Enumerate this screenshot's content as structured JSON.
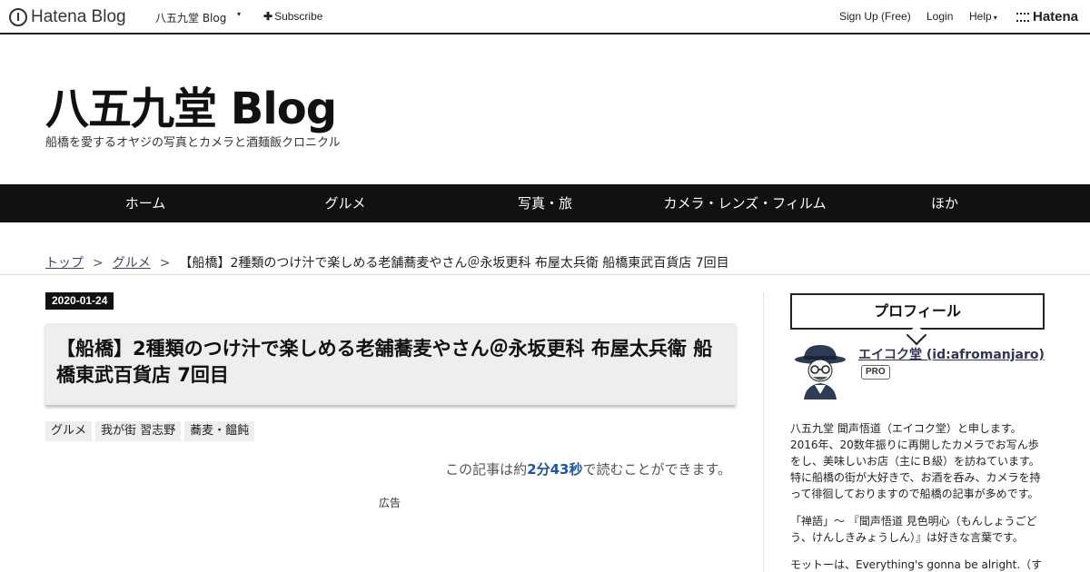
{
  "topbar": {
    "logo_text": "Hatena Blog",
    "blog_selector": "八五九堂 Blog",
    "caret": "▾",
    "subscribe": "Subscribe",
    "signup": "Sign Up (Free)",
    "login": "Login",
    "help": "Help",
    "help_caret": "▾",
    "hatena": "Hatena"
  },
  "header": {
    "title": "八五九堂 Blog",
    "description": "船橋を愛するオヤジの写真とカメラと酒麺飯クロニクル"
  },
  "nav": {
    "items": [
      "ホーム",
      "グルメ",
      "写真・旅",
      "カメラ・レンズ・フィルム",
      "ほか"
    ]
  },
  "breadcrumb": {
    "top": "トップ",
    "category": "グルメ",
    "separator": ">",
    "current": "【船橋】2種類のつけ汁で楽しめる老舗蕎麦やさん＠永坂更科 布屋太兵衛 船橋東武百貨店 7回目"
  },
  "entry": {
    "date": "2020-01-24",
    "title": "【船橋】2種類のつけ汁で楽しめる老舗蕎麦やさん＠永坂更科 布屋太兵衛 船橋東武百貨店 7回目",
    "categories": [
      "グルメ",
      "我が街 習志野",
      "蕎麦・饂飩"
    ],
    "readtime_prefix": "この記事は約",
    "readtime_value": "2分43秒",
    "readtime_suffix": "で読むことができます。",
    "ad_label": "広告"
  },
  "sidebar": {
    "profile_heading": "プロフィール",
    "name": "エイコク堂 (id:afromanjaro)",
    "badge": "PRO",
    "bio_1": "八五九堂 聞声悟道（エイコク堂）と申します。2016年、20数年振りに再開したカメラでお写ん歩をし、美味しいお店（主にＢ級）を訪ねています。特に船橋の街が大好きで、お酒を呑み、カメラを持って徘徊しておりますので船橋の記事が多めです。",
    "bio_2": "「禅語」～ 『聞声悟道 見色明心（もんしょうごどう、けんしきみょうしん）』は好きな言葉です。",
    "bio_3": "モットーは、Everything's gonna be alright.（すべ"
  },
  "colors": {
    "nav_bg": "#111111",
    "readtime_accent": "#1a56a8",
    "title_box_bg": "#eeeeee"
  }
}
